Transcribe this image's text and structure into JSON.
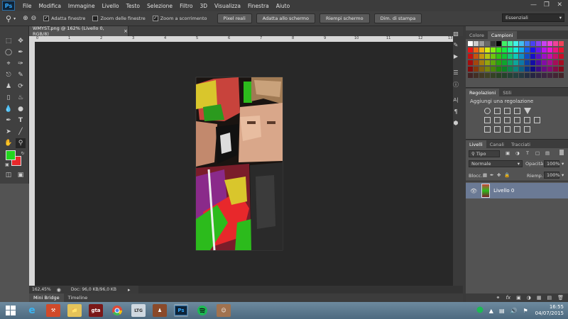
{
  "app": {
    "logo": "Ps"
  },
  "menu": [
    "File",
    "Modifica",
    "Immagine",
    "Livello",
    "Testo",
    "Selezione",
    "Filtro",
    "3D",
    "Visualizza",
    "Finestra",
    "Aiuto"
  ],
  "window_controls": [
    "minimize-icon",
    "restore-icon",
    "close-icon"
  ],
  "options": {
    "checkboxes": [
      {
        "label": "Adatta finestre",
        "checked": true
      },
      {
        "label": "Zoom delle finestre",
        "checked": false
      },
      {
        "label": "Zoom a scorrimento",
        "checked": true
      }
    ],
    "buttons": [
      "Pixel reali",
      "Adatta allo schermo",
      "Riempi schermo",
      "Dim. di stampa"
    ],
    "workspace": "Essenziali"
  },
  "document": {
    "tab_title": "WMYST.png @ 162% (Livello 0, RGB/8)",
    "ruler_labels": [
      "0",
      "1",
      "2",
      "3",
      "4",
      "5",
      "6",
      "7",
      "8",
      "9",
      "10",
      "11",
      "12",
      "13"
    ],
    "zoom": "162,45%",
    "doc_info": "Doc: 96,0 KB/96,0 KB"
  },
  "colors": {
    "foreground": "#22d61e",
    "background": "#e8282b"
  },
  "bottom_tabs": [
    "Mini Bridge",
    "Timeline"
  ],
  "panels": {
    "swatches": {
      "tabs": [
        "Colore",
        "Campioni"
      ],
      "active": 1
    },
    "adjustments": {
      "tabs": [
        "Regolazioni",
        "Stili"
      ],
      "active": 0,
      "title": "Aggiungi una regolazione"
    },
    "layers": {
      "tabs": [
        "Livelli",
        "Canali",
        "Tracciati"
      ],
      "active": 0,
      "filter": "Tipo",
      "blend": "Normale",
      "opacity_label": "Opacità:",
      "opacity": "100%",
      "lock_label": "Blocc.:",
      "fill_label": "Riemp.:",
      "fill": "100%",
      "layer_name": "Livello 0"
    }
  },
  "taskbar": {
    "time": "16:55",
    "date": "04/07/2015",
    "icons": [
      "ie",
      "tools",
      "explorer",
      "gta",
      "chrome",
      "ltg",
      "game",
      "photoshop",
      "spotify",
      "avatar"
    ]
  }
}
